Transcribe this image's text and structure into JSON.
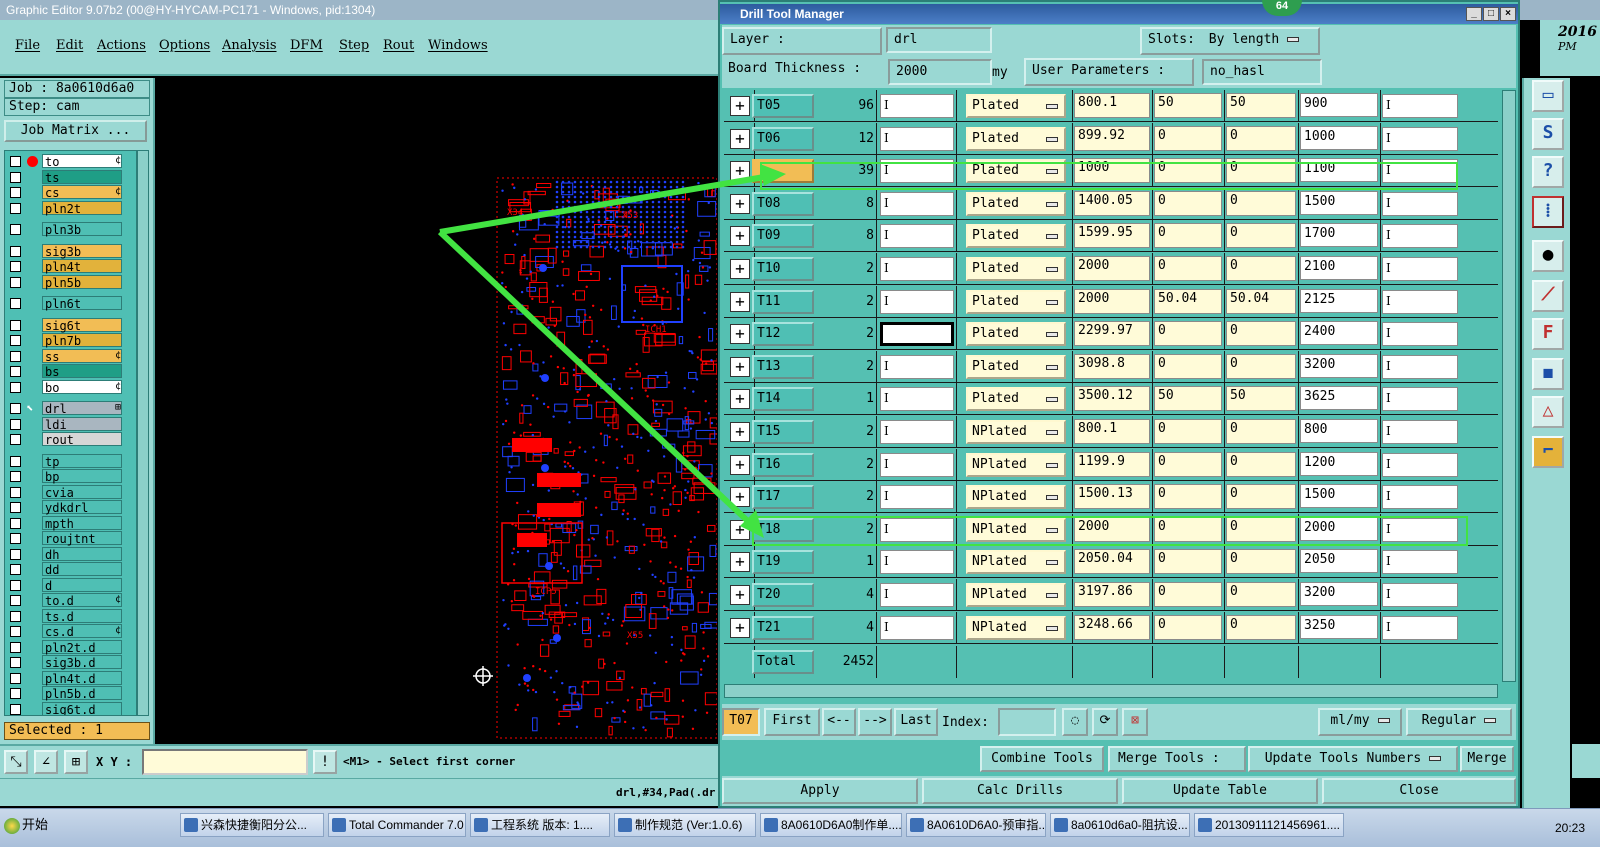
{
  "window": {
    "title": "Graphic Editor 9.07b2 (00@HY-HYCAM-PC171 - Windows, pid:1304)",
    "date": "2016",
    "ampm": "PM"
  },
  "menu": [
    "File",
    "Edit",
    "Actions",
    "Options",
    "Analysis",
    "DFM",
    "Step",
    "Rout",
    "Windows"
  ],
  "left": {
    "job": "Job : 8a0610d6a0",
    "step": "Step: cam",
    "job_matrix": "Job Matrix ...",
    "selected": "Selected : 1",
    "layers": [
      {
        "name": "to",
        "bg": "#ffffff",
        "dot": true,
        "flag": "¢"
      },
      {
        "name": "ts",
        "bg": "#1f9e86"
      },
      {
        "name": "cs",
        "bg": "#f2bd55",
        "flag": "¢"
      },
      {
        "name": "pln2t",
        "bg": "#e2b23b"
      },
      {
        "name": "pln3b",
        "bg": "#4fbfb4",
        "gap": true
      },
      {
        "name": "sig3b",
        "bg": "#f2bd55",
        "gap": true
      },
      {
        "name": "pln4t",
        "bg": "#e2b23b"
      },
      {
        "name": "pln5b",
        "bg": "#e2b23b"
      },
      {
        "name": "pln6t",
        "bg": "#4fbfb4",
        "gap": true
      },
      {
        "name": "sig6t",
        "bg": "#f2bd55",
        "gap": true
      },
      {
        "name": "pln7b",
        "bg": "#e2b23b"
      },
      {
        "name": "ss",
        "bg": "#f2bd55",
        "flag": "¢"
      },
      {
        "name": "bs",
        "bg": "#1f9e86"
      },
      {
        "name": "bo",
        "bg": "#ffffff",
        "flag": "¢"
      },
      {
        "name": "drl",
        "bg": "#a9b6c0",
        "arrow": true,
        "gap": true,
        "flag": "⊞"
      },
      {
        "name": "ldi",
        "bg": "#a9b6c0"
      },
      {
        "name": "rout",
        "bg": "#d6d6d6"
      },
      {
        "name": "tp",
        "bg": "#4fbfb4",
        "gap": true
      },
      {
        "name": "bp",
        "bg": "#4fbfb4"
      },
      {
        "name": "cvia",
        "bg": "#4fbfb4"
      },
      {
        "name": "ydkdrl",
        "bg": "#4fbfb4"
      },
      {
        "name": "mpth",
        "bg": "#4fbfb4"
      },
      {
        "name": "roujtnt",
        "bg": "#4fbfb4"
      },
      {
        "name": "dh",
        "bg": "#4fbfb4"
      },
      {
        "name": "dd",
        "bg": "#4fbfb4"
      },
      {
        "name": "d",
        "bg": "#4fbfb4"
      },
      {
        "name": "to.d",
        "bg": "#4fbfb4",
        "flag": "¢"
      },
      {
        "name": "ts.d",
        "bg": "#4fbfb4"
      },
      {
        "name": "cs.d",
        "bg": "#4fbfb4",
        "flag": "¢"
      },
      {
        "name": "pln2t.d",
        "bg": "#4fbfb4"
      },
      {
        "name": "sig3b.d",
        "bg": "#4fbfb4"
      },
      {
        "name": "pln4t.d",
        "bg": "#4fbfb4"
      },
      {
        "name": "pln5b.d",
        "bg": "#4fbfb4"
      },
      {
        "name": "sig6t.d",
        "bg": "#4fbfb4"
      }
    ]
  },
  "canvas_labels": [
    "X34",
    "X53",
    "ICH1",
    "ICP5",
    "X55"
  ],
  "bottom": {
    "xy_label": "X Y :",
    "xy_value": "",
    "prompt": "<M1> - Select first corner",
    "status": "drl,#34,Pad(.dr"
  },
  "dtm": {
    "title": "Drill Tool Manager",
    "badge": "64",
    "layer_label": "Layer          :",
    "layer_value": "drl",
    "slots_label": "Slots:",
    "slots_value": "By length",
    "board_thickness_label": "Board Thickness :",
    "board_thickness_value": "2000",
    "units": "my",
    "user_params_label": "User Parameters :",
    "user_params_value": "no_hasl",
    "rows": [
      {
        "tool": "T05",
        "count": "96",
        "type": "Plated",
        "size": "800.1",
        "tol_plus": "50",
        "tol_minus": "50",
        "finish": "900"
      },
      {
        "tool": "T06",
        "count": "12",
        "type": "Plated",
        "size": "899.92",
        "tol_plus": "0",
        "tol_minus": "0",
        "finish": "1000"
      },
      {
        "tool": "",
        "count": "39",
        "type": "Plated",
        "size": "1000",
        "tol_plus": "0",
        "tol_minus": "0",
        "finish": "1100",
        "selected": true
      },
      {
        "tool": "T08",
        "count": "8",
        "type": "Plated",
        "size": "1400.05",
        "tol_plus": "0",
        "tol_minus": "0",
        "finish": "1500"
      },
      {
        "tool": "T09",
        "count": "8",
        "type": "Plated",
        "size": "1599.95",
        "tol_plus": "0",
        "tol_minus": "0",
        "finish": "1700"
      },
      {
        "tool": "T10",
        "count": "2",
        "type": "Plated",
        "size": "2000",
        "tol_plus": "0",
        "tol_minus": "0",
        "finish": "2100"
      },
      {
        "tool": "T11",
        "count": "2",
        "type": "Plated",
        "size": "2000",
        "tol_plus": "50.04",
        "tol_minus": "50.04",
        "finish": "2125"
      },
      {
        "tool": "T12",
        "count": "2",
        "type": "Plated",
        "size": "2299.97",
        "tol_plus": "0",
        "tol_minus": "0",
        "finish": "2400",
        "focus": true
      },
      {
        "tool": "T13",
        "count": "2",
        "type": "Plated",
        "size": "3098.8",
        "tol_plus": "0",
        "tol_minus": "0",
        "finish": "3200"
      },
      {
        "tool": "T14",
        "count": "1",
        "type": "Plated",
        "size": "3500.12",
        "tol_plus": "50",
        "tol_minus": "50",
        "finish": "3625"
      },
      {
        "tool": "T15",
        "count": "2",
        "type": "NPlated",
        "size": "800.1",
        "tol_plus": "0",
        "tol_minus": "0",
        "finish": "800"
      },
      {
        "tool": "T16",
        "count": "2",
        "type": "NPlated",
        "size": "1199.9",
        "tol_plus": "0",
        "tol_minus": "0",
        "finish": "1200"
      },
      {
        "tool": "T17",
        "count": "2",
        "type": "NPlated",
        "size": "1500.13",
        "tol_plus": "0",
        "tol_minus": "0",
        "finish": "1500"
      },
      {
        "tool": "T18",
        "count": "2",
        "type": "NPlated",
        "size": "2000",
        "tol_plus": "0",
        "tol_minus": "0",
        "finish": "2000"
      },
      {
        "tool": "T19",
        "count": "1",
        "type": "NPlated",
        "size": "2050.04",
        "tol_plus": "0",
        "tol_minus": "0",
        "finish": "2050"
      },
      {
        "tool": "T20",
        "count": "4",
        "type": "NPlated",
        "size": "3197.86",
        "tol_plus": "0",
        "tol_minus": "0",
        "finish": "3200"
      },
      {
        "tool": "T21",
        "count": "4",
        "type": "NPlated",
        "size": "3248.66",
        "tol_plus": "0",
        "tol_minus": "0",
        "finish": "3250"
      }
    ],
    "total_label": "Total",
    "total_value": "2452",
    "nav": {
      "current_tool": "T07",
      "first": "First",
      "prev": "<--",
      "next": "-->",
      "last": "Last",
      "index_label": "Index:",
      "index_value": "",
      "units_option": "ml/my",
      "mode_option": "Regular"
    },
    "actions": {
      "combine": "Combine Tools",
      "merge_tools_label": "Merge Tools  :",
      "merge_tools_option": "Update Tools Numbers",
      "merge": "Merge",
      "apply": "Apply",
      "calc": "Calc Drills",
      "update": "Update Table",
      "close": "Close"
    }
  },
  "taskbar": {
    "start": "开始",
    "items": [
      "兴森快捷衡阳分公...",
      "Total Commander 7.0 ...",
      "工程系统  版本: 1....",
      "制作规范 (Ver:1.0.6)",
      "8A0610D6A0制作单....",
      "8A0610D6A0-预审指...",
      "8a0610d6a0-阻抗设...",
      "20130911121456961...."
    ],
    "clock": "20:23"
  },
  "colors": {
    "panel": "#9ad8d3",
    "grid": "#55c0b2",
    "highlight": "#42e342",
    "editable_field": "#fffbd8",
    "pcb_top": "#ff0000",
    "pcb_bottom": "#2040ff"
  }
}
